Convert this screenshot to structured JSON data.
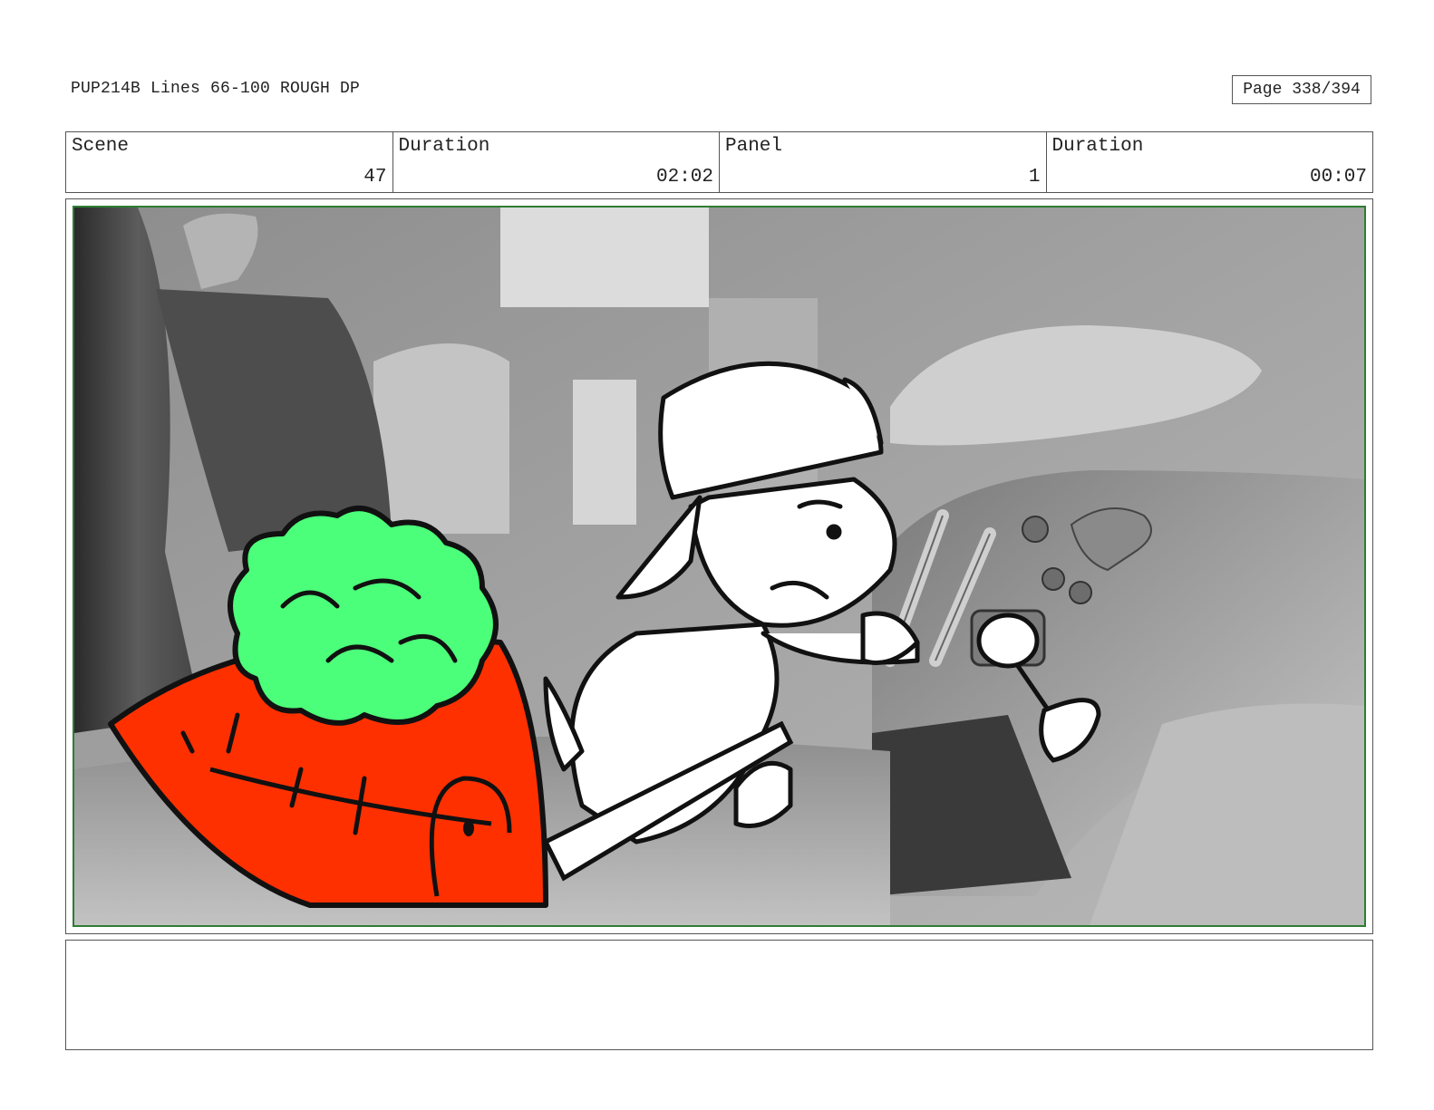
{
  "header": {
    "title": "PUP214B Lines 66-100 ROUGH DP",
    "page": "Page 338/394"
  },
  "info": {
    "scene_label": "Scene",
    "scene_value": "47",
    "scene_duration_label": "Duration",
    "scene_duration_value": "02:02",
    "panel_label": "Panel",
    "panel_value": "1",
    "panel_duration_label": "Duration",
    "panel_duration_value": "00:07"
  },
  "panel": {
    "description": "",
    "colors": {
      "frame_border": "#2e7d32",
      "carrot": "#ff3000",
      "carrot_top": "#4cff7a",
      "background_gray": "#9a9a9a"
    }
  },
  "notes": {
    "text": ""
  }
}
